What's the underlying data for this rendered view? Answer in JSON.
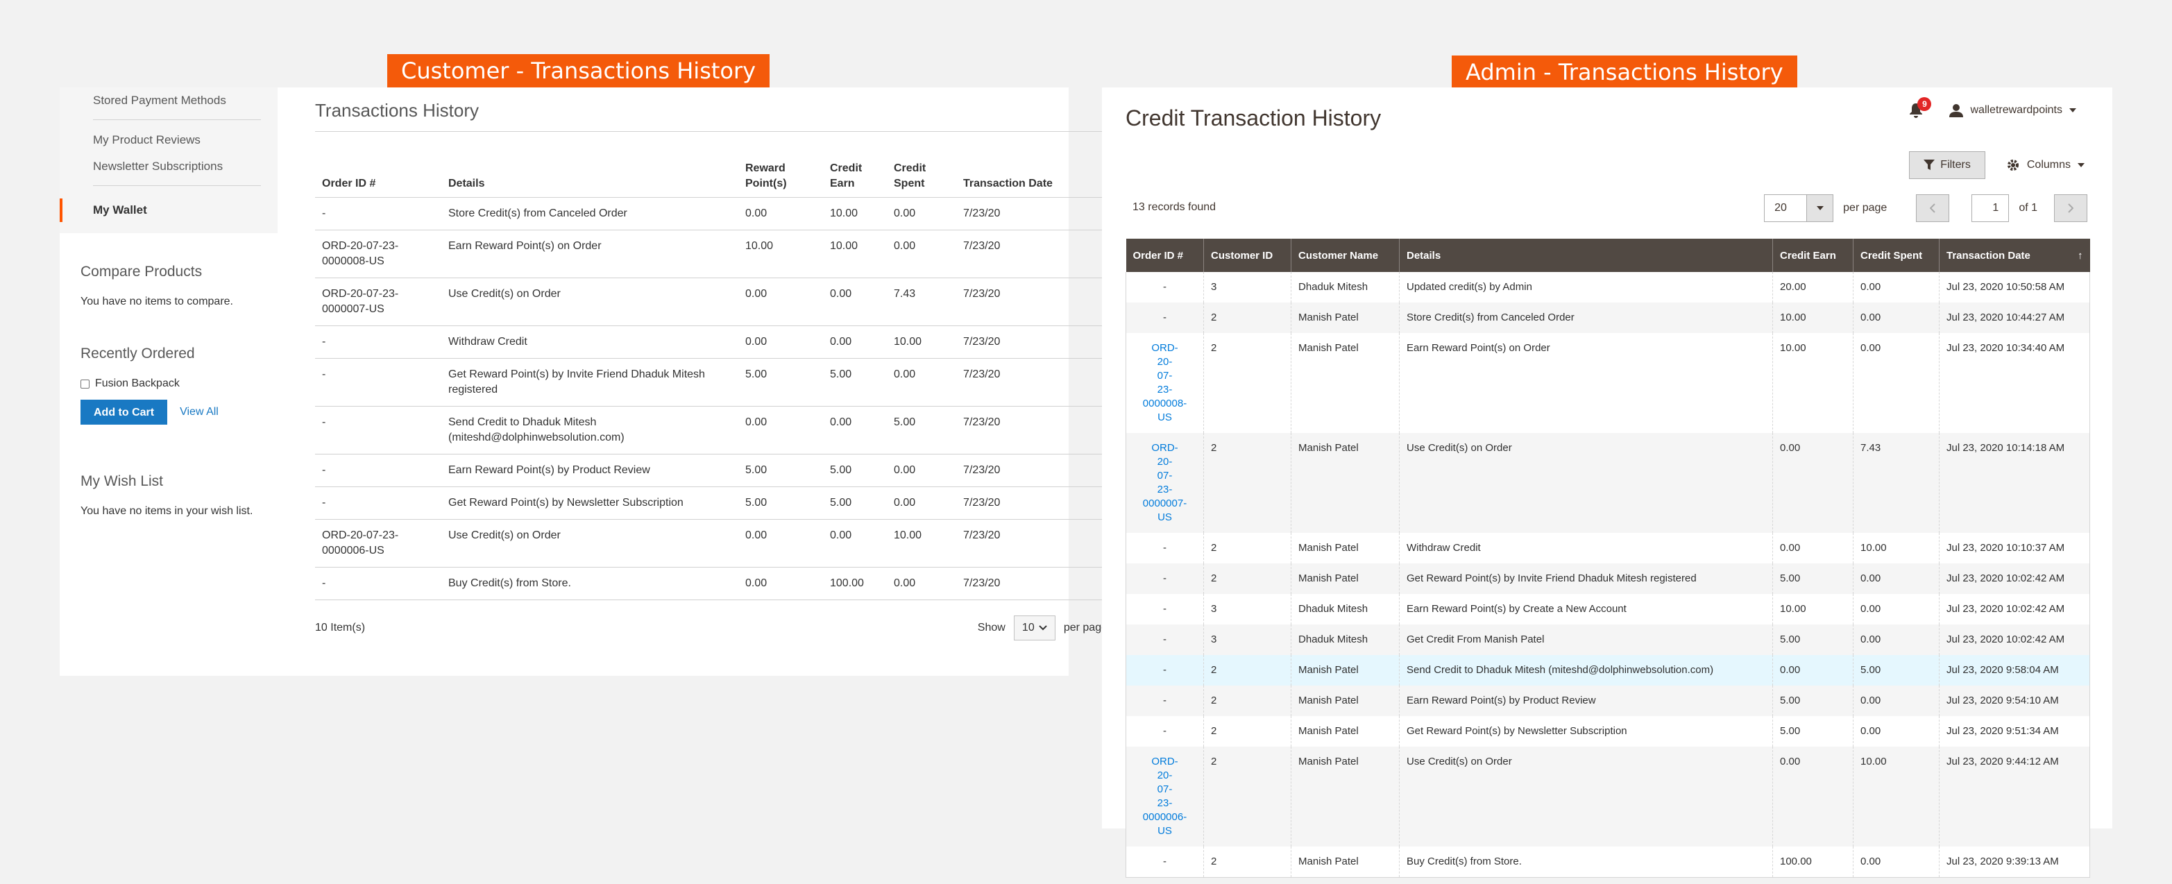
{
  "banners": {
    "customer": "Customer - Transactions History",
    "admin": "Admin - Transactions History"
  },
  "customer": {
    "sidebar": {
      "nav": [
        "Stored Payment Methods",
        "My Product Reviews",
        "Newsletter Subscriptions",
        "My Wallet"
      ],
      "compare": {
        "title": "Compare Products",
        "text": "You have no items to compare."
      },
      "recent": {
        "title": "Recently Ordered",
        "item": "Fusion Backpack",
        "add_to_cart": "Add to Cart",
        "view_all": "View All"
      },
      "wishlist": {
        "title": "My Wish List",
        "text": "You have no items in your wish list."
      }
    },
    "title": "Transactions History",
    "columns": [
      "Order ID #",
      "Details",
      "Reward Point(s)",
      "Credit Earn",
      "Credit Spent",
      "Transaction Date"
    ],
    "rows": [
      [
        "-",
        "Store Credit(s) from Canceled Order",
        "0.00",
        "10.00",
        "0.00",
        "7/23/20"
      ],
      [
        "ORD-20-07-23-0000008-US",
        "Earn Reward Point(s) on Order",
        "10.00",
        "10.00",
        "0.00",
        "7/23/20"
      ],
      [
        "ORD-20-07-23-0000007-US",
        "Use Credit(s) on Order",
        "0.00",
        "0.00",
        "7.43",
        "7/23/20"
      ],
      [
        "-",
        "Withdraw Credit",
        "0.00",
        "0.00",
        "10.00",
        "7/23/20"
      ],
      [
        "-",
        "Get Reward Point(s) by Invite Friend Dhaduk Mitesh registered",
        "5.00",
        "5.00",
        "0.00",
        "7/23/20"
      ],
      [
        "-",
        "Send Credit to Dhaduk Mitesh (miteshd@dolphinwebsolution.com)",
        "0.00",
        "0.00",
        "5.00",
        "7/23/20"
      ],
      [
        "-",
        "Earn Reward Point(s) by Product Review",
        "5.00",
        "5.00",
        "0.00",
        "7/23/20"
      ],
      [
        "-",
        "Get Reward Point(s) by Newsletter Subscription",
        "5.00",
        "5.00",
        "0.00",
        "7/23/20"
      ],
      [
        "ORD-20-07-23-0000006-US",
        "Use Credit(s) on Order",
        "0.00",
        "0.00",
        "10.00",
        "7/23/20"
      ],
      [
        "-",
        "Buy Credit(s) from Store.",
        "0.00",
        "100.00",
        "0.00",
        "7/23/20"
      ]
    ],
    "footer": {
      "count": "10 Item(s)",
      "show": "Show",
      "limit": "10",
      "per_page": "per page"
    }
  },
  "admin": {
    "title": "Credit Transaction History",
    "notifications": "9",
    "username": "walletrewardpoints",
    "filters": "Filters",
    "columns_btn": "Columns",
    "records": "13 records found",
    "per_page_value": "20",
    "per_page": "per page",
    "page": "1",
    "of_pages": "of 1",
    "columns": [
      "Order ID #",
      "Customer ID",
      "Customer Name",
      "Details",
      "Credit Earn",
      "Credit Spent",
      "Transaction Date"
    ],
    "rows": [
      [
        "-",
        "3",
        "Dhaduk Mitesh",
        "Updated credit(s) by Admin",
        "20.00",
        "0.00",
        "Jul 23, 2020 10:50:58 AM"
      ],
      [
        "-",
        "2",
        "Manish Patel",
        "Store Credit(s) from Canceled Order",
        "10.00",
        "0.00",
        "Jul 23, 2020 10:44:27 AM"
      ],
      [
        "ORD-20-07-23-0000008-US",
        "2",
        "Manish Patel",
        "Earn Reward Point(s) on Order",
        "10.00",
        "0.00",
        "Jul 23, 2020 10:34:40 AM"
      ],
      [
        "ORD-20-07-23-0000007-US",
        "2",
        "Manish Patel",
        "Use Credit(s) on Order",
        "0.00",
        "7.43",
        "Jul 23, 2020 10:14:18 AM"
      ],
      [
        "-",
        "2",
        "Manish Patel",
        "Withdraw Credit",
        "0.00",
        "10.00",
        "Jul 23, 2020 10:10:37 AM"
      ],
      [
        "-",
        "2",
        "Manish Patel",
        "Get Reward Point(s) by Invite Friend Dhaduk Mitesh registered",
        "5.00",
        "0.00",
        "Jul 23, 2020 10:02:42 AM"
      ],
      [
        "-",
        "3",
        "Dhaduk Mitesh",
        "Earn Reward Point(s) by Create a New Account",
        "10.00",
        "0.00",
        "Jul 23, 2020 10:02:42 AM"
      ],
      [
        "-",
        "3",
        "Dhaduk Mitesh",
        "Get Credit From Manish Patel",
        "5.00",
        "0.00",
        "Jul 23, 2020 10:02:42 AM"
      ],
      [
        "-",
        "2",
        "Manish Patel",
        "Send Credit to Dhaduk Mitesh (miteshd@dolphinwebsolution.com)",
        "0.00",
        "5.00",
        "Jul 23, 2020 9:58:04 AM"
      ],
      [
        "-",
        "2",
        "Manish Patel",
        "Earn Reward Point(s) by Product Review",
        "5.00",
        "0.00",
        "Jul 23, 2020 9:54:10 AM"
      ],
      [
        "-",
        "2",
        "Manish Patel",
        "Get Reward Point(s) by Newsletter Subscription",
        "5.00",
        "0.00",
        "Jul 23, 2020 9:51:34 AM"
      ],
      [
        "ORD-20-07-23-0000006-US",
        "2",
        "Manish Patel",
        "Use Credit(s) on Order",
        "0.00",
        "10.00",
        "Jul 23, 2020 9:44:12 AM"
      ],
      [
        "-",
        "2",
        "Manish Patel",
        "Buy Credit(s) from Store.",
        "100.00",
        "0.00",
        "Jul 23, 2020 9:39:13 AM"
      ]
    ],
    "highlight_row": 8
  },
  "colors": {
    "banner": "#f45a0a",
    "admin_header": "#514943",
    "link": "#1979c3"
  }
}
